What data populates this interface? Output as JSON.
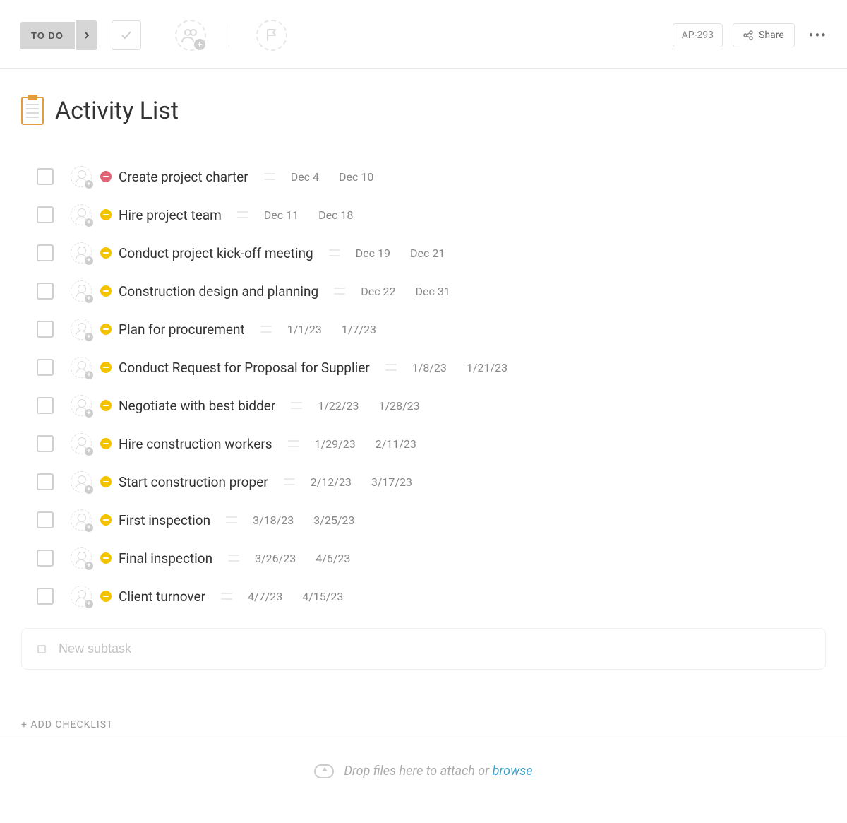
{
  "toolbar": {
    "status_label": "TO DO",
    "task_id": "AP-293",
    "share_label": "Share"
  },
  "page": {
    "title": "Activity List",
    "add_checklist_label": "+ ADD CHECKLIST",
    "new_subtask_placeholder": "New subtask",
    "drop_text": "Drop files here to attach or ",
    "drop_link": "browse"
  },
  "tasks": [
    {
      "title": "Create project charter",
      "start": "Dec 4",
      "end": "Dec 10",
      "priority": "red"
    },
    {
      "title": "Hire project team",
      "start": "Dec 11",
      "end": "Dec 18",
      "priority": "yellow"
    },
    {
      "title": "Conduct project kick-off meeting",
      "start": "Dec 19",
      "end": "Dec 21",
      "priority": "yellow"
    },
    {
      "title": "Construction design and planning",
      "start": "Dec 22",
      "end": "Dec 31",
      "priority": "yellow"
    },
    {
      "title": "Plan for procurement",
      "start": "1/1/23",
      "end": "1/7/23",
      "priority": "yellow"
    },
    {
      "title": "Conduct Request for Proposal for Supplier",
      "start": "1/8/23",
      "end": "1/21/23",
      "priority": "yellow"
    },
    {
      "title": "Negotiate with best bidder",
      "start": "1/22/23",
      "end": "1/28/23",
      "priority": "yellow"
    },
    {
      "title": "Hire construction workers",
      "start": "1/29/23",
      "end": "2/11/23",
      "priority": "yellow"
    },
    {
      "title": "Start construction proper",
      "start": "2/12/23",
      "end": "3/17/23",
      "priority": "yellow"
    },
    {
      "title": "First inspection",
      "start": "3/18/23",
      "end": "3/25/23",
      "priority": "yellow"
    },
    {
      "title": "Final inspection",
      "start": "3/26/23",
      "end": "4/6/23",
      "priority": "yellow"
    },
    {
      "title": "Client turnover",
      "start": "4/7/23",
      "end": "4/15/23",
      "priority": "yellow"
    }
  ]
}
